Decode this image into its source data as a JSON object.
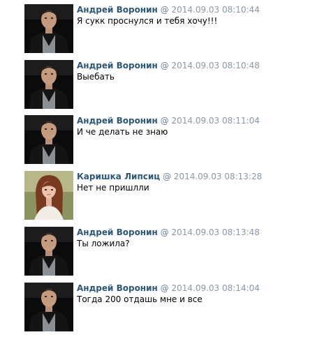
{
  "messages": [
    {
      "author": "Андрей Воронин",
      "separator": "@",
      "time": "2014.09.03 08:10:44",
      "text": "Я сукк проснулся и тебя хочу!!!",
      "avatar": "male"
    },
    {
      "author": "Андрей Воронин",
      "separator": "@",
      "time": "2014.09.03 08:10:48",
      "text": "Выебать",
      "avatar": "male"
    },
    {
      "author": "Андрей Воронин",
      "separator": "@",
      "time": "2014.09.03 08:11:04",
      "text": "И че делать не знаю",
      "avatar": "male"
    },
    {
      "author": "Каришка Липсиц",
      "separator": "@",
      "time": "2014.09.03 08:13:28",
      "text": "Нет не пришлли",
      "avatar": "female"
    },
    {
      "author": "Андрей Воронин",
      "separator": "@",
      "time": "2014.09.03 08:13:48",
      "text": "Ты ложила?",
      "avatar": "male"
    },
    {
      "author": "Андрей Воронин",
      "separator": "@",
      "time": "2014.09.03 08:14:04",
      "text": "Тогда 200 отдашь мне и все",
      "avatar": "male"
    }
  ],
  "colors": {
    "author": "#2b587a",
    "time": "#8a98a8",
    "text": "#000000",
    "background": "#ffffff"
  }
}
